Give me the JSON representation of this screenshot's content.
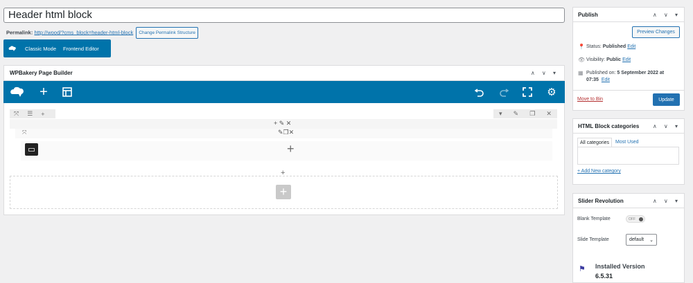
{
  "post": {
    "title": "Header html block",
    "permalink_label": "Permalink:",
    "permalink_url": "http://wood/?cms_block=header-html-block",
    "change_permalink_label": "Change Permalink Structure"
  },
  "mode_bar": {
    "classic_label": "Classic Mode",
    "frontend_label": "Frontend Editor"
  },
  "wpbakery": {
    "title": "WPBakery Page Builder"
  },
  "publish": {
    "title": "Publish",
    "preview_label": "Preview Changes",
    "status_label": "Status:",
    "status_value": "Published",
    "status_edit": "Edit",
    "visibility_label": "Visibility:",
    "visibility_value": "Public",
    "visibility_edit": "Edit",
    "published_on_label": "Published on:",
    "published_on_value": "5 September 2022 at",
    "published_on_time": "07:35",
    "published_edit": "Edit",
    "trash_label": "Move to Bin",
    "update_label": "Update"
  },
  "categories": {
    "title": "HTML Block categories",
    "tab_all": "All categories",
    "tab_most_used": "Most Used",
    "add_new": "+ Add New category"
  },
  "slider": {
    "title": "Slider Revolution",
    "blank_template_label": "Blank Template",
    "toggle_value": "OFF",
    "slide_template_label": "Slide Template",
    "slide_template_value": "default",
    "installed_version_label": "Installed Version",
    "installed_version_value": "6.5.31"
  },
  "colors": {
    "accent": "#0073aa",
    "link": "#2271b1",
    "danger": "#b32d2e"
  }
}
